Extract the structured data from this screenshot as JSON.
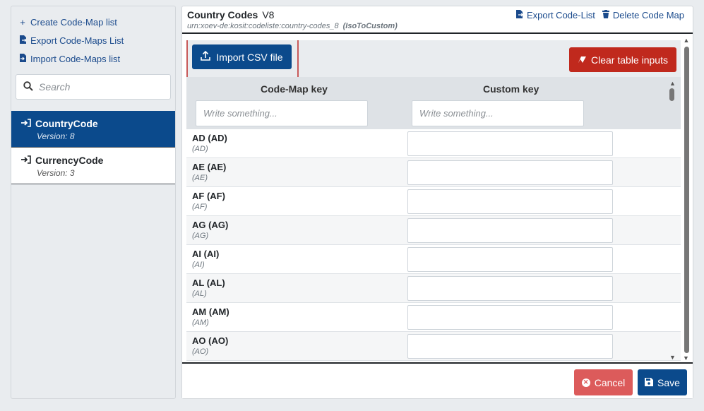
{
  "sidebar": {
    "links": [
      {
        "icon": "plus-icon",
        "glyph": "+",
        "label": "Create Code-Map list"
      },
      {
        "icon": "export-icon",
        "glyph": "⇥",
        "label": "Export Code-Maps List"
      },
      {
        "icon": "import-icon",
        "glyph": "⇤",
        "label": "Import Code-Maps list"
      }
    ],
    "search_placeholder": "Search",
    "items": [
      {
        "name": "CountryCode",
        "version": "Version: 8",
        "active": true
      },
      {
        "name": "CurrencyCode",
        "version": "Version: 3",
        "active": false
      }
    ]
  },
  "header": {
    "title": "Country Codes",
    "version": "V8",
    "urn": "urn:xoev-de:kosit:codeliste:country-codes_8",
    "mapping": "(IsoToCustom)",
    "export_label": "Export Code-List",
    "delete_label": "Delete Code Map"
  },
  "toolbar": {
    "import_label": "Import CSV file",
    "clear_label": "Clear table inputs"
  },
  "table": {
    "col_key": "Code-Map key",
    "col_custom": "Custom key",
    "filter_placeholder": "Write something...",
    "rows": [
      {
        "key": "AD (AD)",
        "sub": "(AD)"
      },
      {
        "key": "AE (AE)",
        "sub": "(AE)"
      },
      {
        "key": "AF (AF)",
        "sub": "(AF)"
      },
      {
        "key": "AG (AG)",
        "sub": "(AG)"
      },
      {
        "key": "AI (AI)",
        "sub": "(AI)"
      },
      {
        "key": "AL (AL)",
        "sub": "(AL)"
      },
      {
        "key": "AM (AM)",
        "sub": "(AM)"
      },
      {
        "key": "AO (AO)",
        "sub": "(AO)"
      }
    ]
  },
  "footer": {
    "cancel_label": "Cancel",
    "save_label": "Save"
  },
  "colors": {
    "primary": "#0b4a8c",
    "danger": "#c0291d",
    "cancel": "#dc5b5b",
    "highlight": "#c85a5a"
  }
}
